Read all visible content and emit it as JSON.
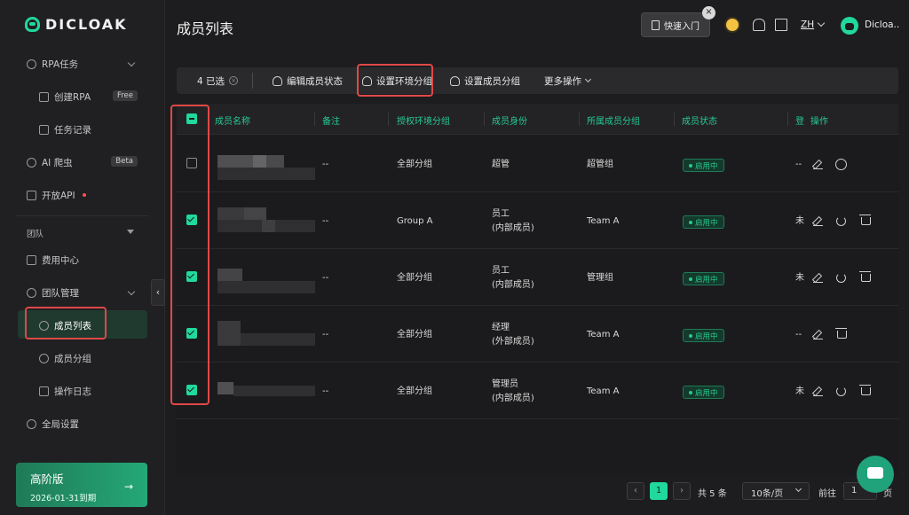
{
  "brand": {
    "name": "DICLOAK"
  },
  "sidebar": {
    "items": [
      {
        "label": "RPA任务"
      },
      {
        "label": "创建RPA",
        "badge": "Free"
      },
      {
        "label": "任务记录"
      },
      {
        "label": "AI 爬虫",
        "badge": "Beta"
      },
      {
        "label": "开放API"
      },
      {
        "label": "团队"
      },
      {
        "label": "费用中心"
      },
      {
        "label": "团队管理"
      },
      {
        "label": "成员列表"
      },
      {
        "label": "成员分组"
      },
      {
        "label": "操作日志"
      },
      {
        "label": "全局设置"
      }
    ],
    "plan": {
      "name": "高阶版",
      "expiry": "2026-01-31到期",
      "arrow": "→"
    },
    "collapse": "‹"
  },
  "header": {
    "title": "成员列表",
    "quick_start": "快速入门",
    "close": "×",
    "lang": "ZH",
    "user": "Dicloa..."
  },
  "toolbar": {
    "selected": "4 已选",
    "clear": "×",
    "edit_status": "编辑成员状态",
    "set_env_group": "设置环境分组",
    "set_member_group": "设置成员分组",
    "more": "更多操作"
  },
  "table": {
    "columns": [
      "成员名称",
      "备注",
      "授权环境分组",
      "成员身份",
      "所属成员分组",
      "成员状态",
      "登",
      "操作"
    ],
    "rows": [
      {
        "checked": false,
        "note": "--",
        "env_group": "全部分组",
        "role": "超管",
        "role2": "",
        "member_group": "超管组",
        "status": "启用中",
        "login": "--"
      },
      {
        "checked": true,
        "note": "--",
        "env_group": "Group A",
        "role": "员工",
        "role2": "(内部成员)",
        "member_group": "Team A",
        "status": "启用中",
        "login": "未"
      },
      {
        "checked": true,
        "note": "--",
        "env_group": "全部分组",
        "role": "员工",
        "role2": "(内部成员)",
        "member_group": "管理组",
        "status": "启用中",
        "login": "未"
      },
      {
        "checked": true,
        "note": "--",
        "env_group": "全部分组",
        "role": "经理",
        "role2": "(外部成员)",
        "member_group": "Team A",
        "status": "启用中",
        "login": "--"
      },
      {
        "checked": true,
        "note": "--",
        "env_group": "全部分组",
        "role": "管理员",
        "role2": "(内部成员)",
        "member_group": "Team A",
        "status": "启用中",
        "login": "未"
      }
    ]
  },
  "pagination": {
    "prev": "‹",
    "current": "1",
    "next": "›",
    "total": "共 5 条",
    "page_size": "10条/页",
    "goto_label": "前往",
    "goto_value": "1",
    "page_suffix": "页"
  },
  "colors": {
    "accent": "#20d99b",
    "highlight": "#e04848",
    "background": "#1d1d1f"
  },
  "icons": [
    "logo-icon",
    "chevron-down-icon",
    "robot-icon",
    "list-icon",
    "bug-icon",
    "api-icon",
    "wallet-icon",
    "team-icon",
    "member-icon",
    "group-icon",
    "log-icon",
    "settings-icon",
    "book-icon",
    "bell-icon",
    "sun-icon",
    "edit-icon",
    "person-icon",
    "refresh-icon",
    "trash-icon",
    "chat-icon"
  ]
}
